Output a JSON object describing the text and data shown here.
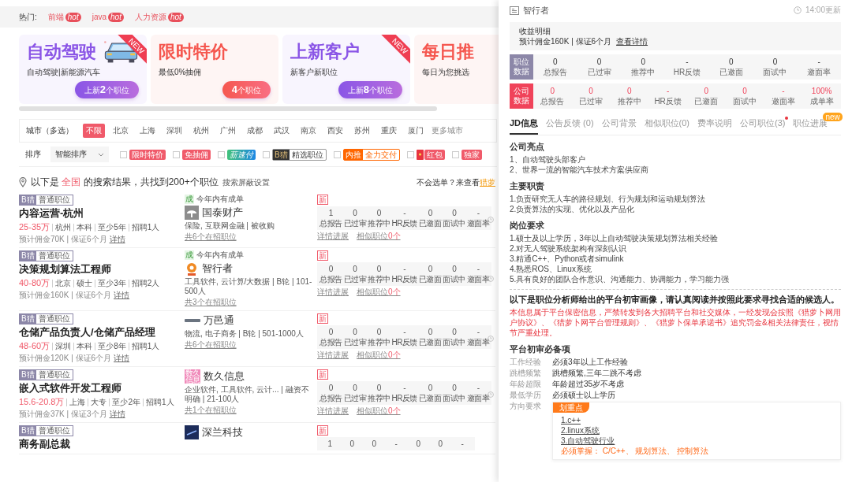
{
  "hot_bar": {
    "label": "热门:",
    "tags": [
      {
        "label": "前端",
        "badge": "hot"
      },
      {
        "label": "java",
        "badge": "hot"
      },
      {
        "label": "人力资源",
        "badge": "hot"
      }
    ]
  },
  "banners": [
    {
      "title": "自动驾驶",
      "subtitle": "自动驾驶|新能源汽车",
      "button": "上新**2**个职位",
      "color": "#8a55e6",
      "ribbon": "NEW",
      "kind": "car"
    },
    {
      "title": "限时特价",
      "subtitle": "最低0%抽佣",
      "button": "**4**个职位",
      "color": "#f5574f",
      "kind": "plain"
    },
    {
      "title": "上新客户",
      "subtitle": "新客户新职位",
      "button": "上新**8**个职位",
      "color": "#8a55e6",
      "ribbon": "NEW",
      "kind": "plain"
    },
    {
      "title": "每日推",
      "subtitle": "每日为您挑选",
      "color": "#f5574f",
      "kind": "plain"
    }
  ],
  "city_filter": {
    "label": "城市（多选）",
    "cities": [
      {
        "label": "不限",
        "selected": true
      },
      {
        "label": "北京",
        "selected": false
      },
      {
        "label": "上海",
        "selected": false
      },
      {
        "label": "深圳",
        "selected": false
      },
      {
        "label": "杭州",
        "selected": false
      },
      {
        "label": "广州",
        "selected": false
      },
      {
        "label": "成都",
        "selected": false
      },
      {
        "label": "武汉",
        "selected": false
      },
      {
        "label": "南京",
        "selected": false
      },
      {
        "label": "西安",
        "selected": false
      },
      {
        "label": "苏州",
        "selected": false
      },
      {
        "label": "重庆",
        "selected": false
      },
      {
        "label": "厦门",
        "selected": false
      }
    ],
    "more": "更多城市"
  },
  "sort": {
    "label": "排序",
    "value": "智能排序",
    "filters": [
      {
        "label": "限时特价",
        "kind": "red",
        "checked": false
      },
      {
        "label": "免抽佣",
        "kind": "red",
        "checked": false
      },
      {
        "label": "薪速付",
        "kind": "blue",
        "checked": false
      },
      {
        "prefix": "B猎",
        "label": "精选职位",
        "kind": "dark",
        "checked": false
      },
      {
        "prefix": "内推",
        "label": "全力交付",
        "kind": "orange",
        "checked": false
      },
      {
        "label": "红包",
        "kind": "packet",
        "checked": false
      },
      {
        "label": "独家",
        "kind": "red",
        "checked": false
      }
    ]
  },
  "results": {
    "summary": "以下是 **全国** 的搜索结果，共找到200+个职位",
    "settings_link": "搜索屏蔽设置",
    "help_text": "不会选单？来查看",
    "help_link": "猎萝"
  },
  "jobs": [
    {
      "tier": "B猎",
      "type": "普通职位",
      "title": "内容运营-杭州",
      "salary": "25-35万",
      "meta": [
        "杭州",
        "本科",
        "至少5年",
        "招聘1人"
      ],
      "commission": "预计佣金70K | 保证6个月",
      "detail_link": "详情",
      "badge_icon": "成",
      "badge": "今年内有成单",
      "kind": "tree",
      "company": "国泰财产",
      "company_info": "保险, 互联网金融 | 被收购",
      "openings": "共6个在招职位",
      "new_tag": "新",
      "stats": [
        {
          "value": "1",
          "label": "总报告"
        },
        {
          "value": "0",
          "label": "已过审"
        },
        {
          "value": "0",
          "label": "推荐中"
        },
        {
          "value": "-",
          "label": "HR反馈"
        },
        {
          "value": "0",
          "label": "已邀面"
        },
        {
          "value": "0",
          "label": "面试中"
        },
        {
          "value": "-",
          "label": "邀面率"
        }
      ],
      "progress_link": "详情进展",
      "similar_link": "相似职位",
      "similar_count": "0个"
    },
    {
      "tier": "B猎",
      "type": "普通职位",
      "title": "决策规划算法工程师",
      "salary": "40-80万",
      "meta": [
        "北京",
        "硕士",
        "至少3年",
        "招聘2人"
      ],
      "commission": "预计佣金160K | 保证6个月",
      "detail_link": "详情",
      "badge_icon": "成",
      "badge": "今年内有成单",
      "kind": "circle",
      "company": "智行者",
      "company_info": "工具软件, 云计算/大数据 | B轮 | 101-500人",
      "openings": "共3个在招职位",
      "new_tag": "新",
      "stats": [
        {
          "value": "0",
          "label": "总报告"
        },
        {
          "value": "0",
          "label": "已过审"
        },
        {
          "value": "0",
          "label": "推荐中"
        },
        {
          "value": "-",
          "label": "HR反馈"
        },
        {
          "value": "0",
          "label": "已邀面"
        },
        {
          "value": "0",
          "label": "面试中"
        },
        {
          "value": "-",
          "label": "邀面率"
        }
      ],
      "progress_link": "详情进展",
      "similar_link": "相似职位",
      "similar_count": "0个"
    },
    {
      "tier": "B猎",
      "type": "普通职位",
      "title": "仓储产品负责人/仓储产品经理",
      "salary": "48-60万",
      "meta": [
        "深圳",
        "本科",
        "至少8年",
        "招聘1人"
      ],
      "commission": "预计佣金120K | 保证6个月",
      "detail_link": "详情",
      "kind": "wordmark",
      "company": "万邑通",
      "company_info": "物流, 电子商务 | B轮 | 501-1000人",
      "openings": "共6个在招职位",
      "new_tag": "新",
      "stats": [
        {
          "value": "0",
          "label": "总报告"
        },
        {
          "value": "0",
          "label": "已过审"
        },
        {
          "value": "0",
          "label": "推荐中"
        },
        {
          "value": "-",
          "label": "HR反馈"
        },
        {
          "value": "0",
          "label": "已邀面"
        },
        {
          "value": "0",
          "label": "面试中"
        },
        {
          "value": "-",
          "label": "邀面率"
        }
      ],
      "progress_link": "详情进展",
      "similar_link": "相似职位",
      "similar_count": "0个"
    },
    {
      "tier": "B猎",
      "type": "普通职位",
      "title": "嵌入式软件开发工程师",
      "salary": "15.6-20.8万",
      "meta": [
        "上海",
        "大专",
        "至少2年",
        "招聘1人"
      ],
      "commission": "预计佣金37K | 保证3个月",
      "detail_link": "详情",
      "kind": "text",
      "logo_text": "数久信息",
      "company": "数久信息",
      "company_info": "企业软件, 工具软件, 云计... | 融资不明确 | 21-100人",
      "openings": "共1个在招职位",
      "new_tag": "新",
      "stats": [
        {
          "value": "0",
          "label": "总报告"
        },
        {
          "value": "0",
          "label": "已过审"
        },
        {
          "value": "0",
          "label": "推荐中"
        },
        {
          "value": "-",
          "label": "HR反馈"
        },
        {
          "value": "0",
          "label": "已邀面"
        },
        {
          "value": "0",
          "label": "面试中"
        },
        {
          "value": "-",
          "label": "邀面率"
        }
      ],
      "progress_link": "详情进展",
      "similar_link": "相似职位",
      "similar_count": "0个"
    },
    {
      "tier": "B猎",
      "type": "普通职位",
      "title": "商务副总裁",
      "kind": "dark",
      "company": "深兰科技",
      "new_tag": "新",
      "stats": [
        {
          "value": "1"
        },
        {
          "value": "0"
        },
        {
          "value": "0"
        },
        {
          "value": "-"
        },
        {
          "value": "0"
        },
        {
          "value": "0"
        },
        {
          "value": "-"
        }
      ]
    }
  ],
  "detail": {
    "company": "智行者",
    "updated": "14:00更新",
    "earnings": {
      "title": "收益明细",
      "text": "预计佣金160K | 保证6个月",
      "link": "查看详情"
    },
    "position_stats": {
      "label": "职位数据",
      "items": [
        {
          "value": "0",
          "label": "总报告"
        },
        {
          "value": "0",
          "label": "已过审"
        },
        {
          "value": "0",
          "label": "推荐中"
        },
        {
          "value": "-",
          "label": "HR反馈"
        },
        {
          "value": "0",
          "label": "已邀面"
        },
        {
          "value": "0",
          "label": "面试中"
        },
        {
          "value": "-",
          "label": "邀面率"
        }
      ]
    },
    "company_stats": {
      "label": "公司数据",
      "items": [
        {
          "value": "0",
          "label": "总报告"
        },
        {
          "value": "0",
          "label": "已过审"
        },
        {
          "value": "0",
          "label": "推荐中"
        },
        {
          "value": "-",
          "label": "HR反馈"
        },
        {
          "value": "0",
          "label": "已邀面"
        },
        {
          "value": "0",
          "label": "面试中"
        },
        {
          "value": "-",
          "label": "邀面率"
        },
        {
          "value": "100%",
          "label": "成单率"
        }
      ]
    },
    "tabs": [
      {
        "label": "JD信息",
        "selected": true,
        "dot": false
      },
      {
        "label": "公告反馈 (0)",
        "selected": false,
        "dot": false
      },
      {
        "label": "公司背景",
        "selected": false,
        "dot": false
      },
      {
        "label": "相似职位(0)",
        "selected": false,
        "dot": false
      },
      {
        "label": "费率说明",
        "selected": false,
        "dot": false
      },
      {
        "label": "公司职位(3)",
        "selected": false,
        "dot": true
      },
      {
        "label": "职位进展",
        "selected": false,
        "dot": false,
        "badge": "new"
      }
    ],
    "sections": [
      {
        "title": "公司亮点",
        "lines": [
          "1、自动驾驶头部客户",
          "2、世界一流的智能汽车技术方案供应商"
        ]
      },
      {
        "title": "主要职责",
        "lines": [
          "1.负责研究无人车的路径规划、行为规划和运动规划算法",
          "2.负责算法的实现、优化以及产品化"
        ]
      },
      {
        "title": "岗位要求",
        "lines": [
          "1.硕士及以上学历，3年以上自动驾驶决策规划算法相关经验",
          "2.对无人驾驶系统架构有深刻认识",
          "3.精通C++、Python或者simulink",
          "4.熟悉ROS、Linux系统",
          "5.具有良好的团队合作意识、沟通能力、协调能力，学习能力强"
        ]
      }
    ],
    "notice": {
      "title": "以下是职位分析师给出的平台初审画像，请认真阅读并按照此要求寻找合适的候选人。",
      "warning": "本信息属于平台保密信息，严禁转发到各大招聘平台和社交媒体，一经发现会按照《猎萝卜网用户协议》、《猎萝卜网平台管理规则》、《猎萝卜保单承诺书》追究罚金&相关法律责任，视情节严重处理。"
    },
    "screening": {
      "title": "平台初审必备项",
      "rows": [
        {
          "label": "工作经验",
          "value": "必须3年以上工作经验"
        },
        {
          "label": "跳槽频繁",
          "value": "跳槽频繁,三年二跳不考虑"
        },
        {
          "label": "年龄超限",
          "value": "年龄超过35岁不考虑"
        },
        {
          "label": "最低学历",
          "value": "必须硕士以上学历"
        }
      ],
      "direction": {
        "label": "方向要求",
        "tag": "划重点",
        "lines": [
          "1.c++",
          "2.linux系统",
          "3.自动驾驶行业"
        ],
        "must": "必须掌握： C/C++、 规划算法、 控制算法"
      }
    }
  }
}
